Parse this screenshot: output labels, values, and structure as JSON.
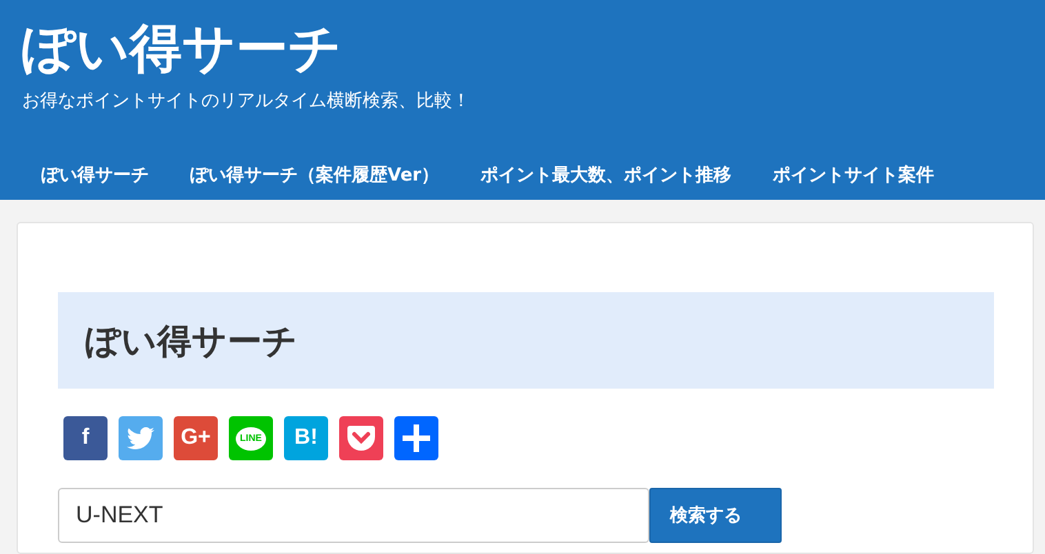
{
  "site": {
    "title": "ぽい得サーチ",
    "tagline": "お得なポイントサイトのリアルタイム横断検索、比較！"
  },
  "nav": [
    "ぽい得サーチ",
    "ぽい得サーチ（案件履歴Ver）",
    "ポイント最大数、ポイント推移",
    "ポイントサイト案件"
  ],
  "page": {
    "heading": "ぽい得サーチ"
  },
  "share_buttons": [
    {
      "kind": "text",
      "label": "f",
      "color": "#3b5998"
    },
    {
      "kind": "bird",
      "color": "#55acee"
    },
    {
      "kind": "text",
      "label": "G+",
      "color": "#dd4b39"
    },
    {
      "kind": "bubble",
      "label": "LINE",
      "color": "#00c300"
    },
    {
      "kind": "text",
      "label": "B!",
      "color": "#00a4de"
    },
    {
      "kind": "pocket",
      "color": "#ef4056"
    },
    {
      "kind": "plus",
      "color": "#0066ff"
    }
  ],
  "search": {
    "value": "U-NEXT",
    "button": "検索する"
  }
}
